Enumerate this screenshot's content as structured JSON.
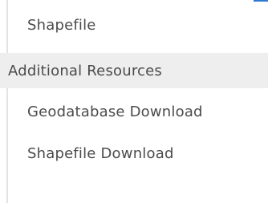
{
  "menu": {
    "items": [
      {
        "label": "Shapefile",
        "type": "child"
      },
      {
        "label": "Additional Resources",
        "type": "group"
      },
      {
        "label": "Geodatabase Download",
        "type": "child"
      },
      {
        "label": "Shapefile Download",
        "type": "child"
      }
    ]
  }
}
